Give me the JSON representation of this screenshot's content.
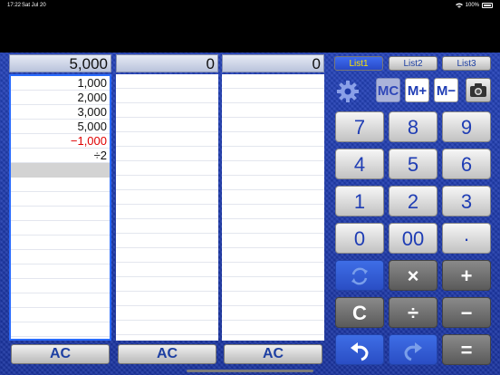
{
  "status": {
    "time": "17:22",
    "date": "Sat Jul 20",
    "battery": "100%"
  },
  "columns": [
    {
      "total": "5,000",
      "entries": [
        "1,000",
        "2,000",
        "3,000",
        "5,000",
        "−1,000",
        "÷2"
      ],
      "ac": "AC"
    },
    {
      "total": "0",
      "entries": [],
      "ac": "AC"
    },
    {
      "total": "0",
      "entries": [],
      "ac": "AC"
    }
  ],
  "tabs": [
    "List1",
    "List2",
    "List3"
  ],
  "memory": {
    "mc": "MC",
    "mplus": "M+",
    "mminus": "M−"
  },
  "keys": {
    "k7": "7",
    "k8": "8",
    "k9": "9",
    "k4": "4",
    "k5": "5",
    "k6": "6",
    "k1": "1",
    "k2": "2",
    "k3": "3",
    "k0": "0",
    "k00": "00",
    "dot": "·",
    "mul": "×",
    "plus": "+",
    "clear": "C",
    "div": "÷",
    "minus": "−",
    "equals": "="
  },
  "colors": {
    "negative": "#e00000",
    "background": "#1e3aa8",
    "active_tab_text": "#ffe400"
  },
  "icons": [
    "gear-icon",
    "camera-icon",
    "sync-icon",
    "undo-icon",
    "redo-icon",
    "wifi-icon",
    "battery-icon"
  ]
}
